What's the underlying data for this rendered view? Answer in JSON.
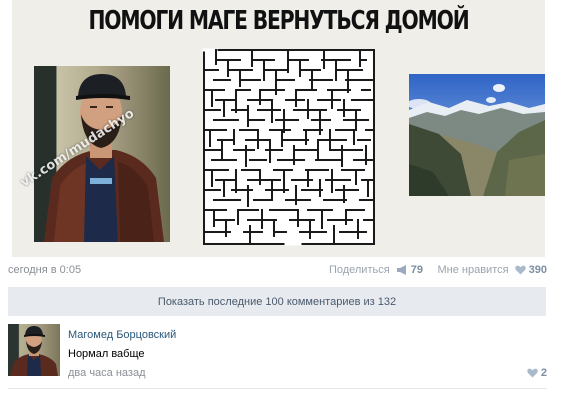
{
  "meme": {
    "title": "ПОМОГИ МАГЕ ВЕРНУТЬСЯ ДОМОЙ",
    "watermark": "vk.com/mudachyo"
  },
  "post": {
    "date": "сегодня в 0:05",
    "share_label": "Поделиться",
    "share_count": "79",
    "like_label": "Мне нравится",
    "like_count": "390"
  },
  "comments_bar": {
    "label": "Показать последние 100 комментариев из 132"
  },
  "comment": {
    "author": "Магомед Борцовский",
    "text": "Нормал вабще",
    "time": "два часа назад",
    "likes": "2"
  },
  "colors": {
    "link": "#2b587a",
    "muted": "#8a8f96",
    "bar_bg": "#e7ebf0",
    "accent": "#7c8ea1"
  }
}
